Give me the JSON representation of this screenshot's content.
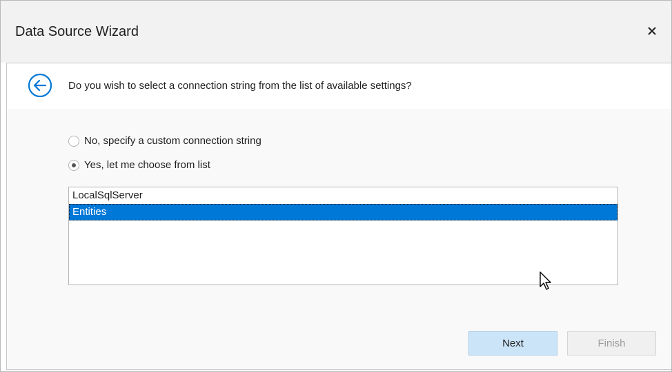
{
  "window": {
    "title": "Data Source Wizard",
    "close_icon": "close-icon"
  },
  "header": {
    "back_icon": "back-arrow-icon",
    "question": "Do you wish to select a connection string from the list of available settings?"
  },
  "options": {
    "custom": {
      "label": "No, specify a custom connection string",
      "checked": false
    },
    "choose": {
      "label": "Yes, let me choose from list",
      "checked": true
    }
  },
  "connections": {
    "items": [
      "LocalSqlServer",
      "Entities"
    ],
    "selected": "Entities"
  },
  "buttons": {
    "next_label": "Next",
    "finish_label": "Finish",
    "finish_enabled": false
  },
  "colors": {
    "accent": "#0078d7",
    "next_bg": "#cce4f7"
  }
}
